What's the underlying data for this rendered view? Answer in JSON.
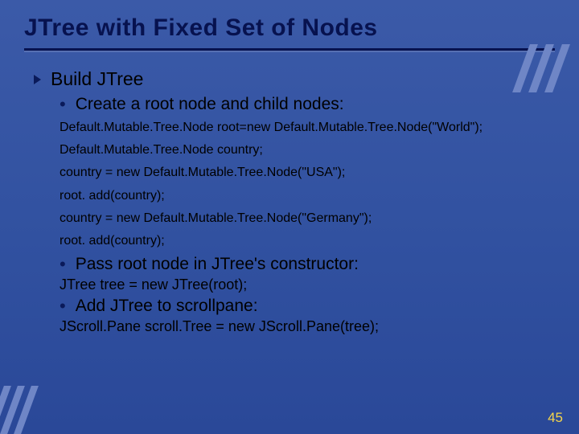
{
  "title": "JTree with Fixed Set of Nodes",
  "bullets": {
    "lvl1": "Build JTree",
    "sub1": "Create a root node and child nodes:",
    "sub2": "Pass root node in JTree's constructor:",
    "sub3": "Add JTree to scrollpane:"
  },
  "code1": {
    "l1": "Default.Mutable.Tree.Node root=new Default.Mutable.Tree.Node(\"World\");",
    "l2": "Default.Mutable.Tree.Node country;",
    "l3": "country = new Default.Mutable.Tree.Node(\"USA\");",
    "l4": "root. add(country);",
    "l5": "country = new Default.Mutable.Tree.Node(\"Germany\");",
    "l6": "root. add(country);"
  },
  "code2": {
    "l1": "JTree tree = new JTree(root);"
  },
  "code3": {
    "l1": "JScroll.Pane scroll.Tree = new JScroll.Pane(tree);"
  },
  "page_number": "45"
}
